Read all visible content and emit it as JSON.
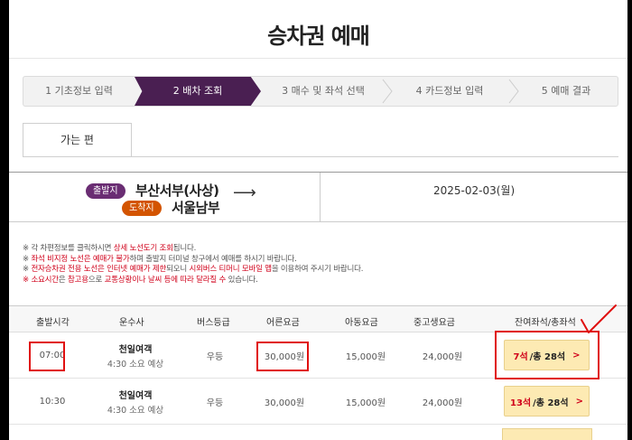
{
  "page": {
    "title": "승차권 예매"
  },
  "steps": [
    {
      "label": "1 기초정보 입력",
      "active": false
    },
    {
      "label": "2 배차 조회",
      "active": true
    },
    {
      "label": "3 매수 및 좌석 선택",
      "active": false
    },
    {
      "label": "4 카드정보 입력",
      "active": false
    },
    {
      "label": "5 예매 결과",
      "active": false
    }
  ],
  "tab": {
    "label": "가는 편"
  },
  "route": {
    "departure_badge": "출발지",
    "departure": "부산서부(사상)",
    "arrival_badge": "도착지",
    "arrival": "서울남부",
    "arrow": "⟶",
    "date": "2025-02-03(월)"
  },
  "notes": {
    "n1a": "※ 각 차편정보를 클릭하시면 ",
    "n1b": "상세 노선도기 조회",
    "n1c": "됩니다.",
    "n2a": "※ ",
    "n2b": "좌석 비지정 노선은 예매가 불가",
    "n2c": "하며 출발지 터미널 창구에서 예매를 하시기 바랍니다.",
    "n3a": "※ ",
    "n3b": "전자승차권 전용 노선은 인터넷 예매가 제한",
    "n3c": "되오니 ",
    "n3d": "시외버스 티머니 모바일 앱",
    "n3e": "을 이용하여 주시기 바랍니다.",
    "n4a": "※ ",
    "n4b": "소요시간",
    "n4c": "은 ",
    "n4d": "참고용",
    "n4e": "으로 ",
    "n4f": "교통상황이나 날씨 등에 따라 달라질 수",
    "n4g": " 있습니다."
  },
  "table": {
    "headers": {
      "time": "출발시각",
      "company": "운수사",
      "grade": "버스등급",
      "adult": "어른요금",
      "child": "아동요금",
      "teen": "중고생요금",
      "seats": "잔여좌석/총좌석"
    },
    "rows": [
      {
        "time": "07:00",
        "company": "천일여객",
        "duration": "4:30 소요 예상",
        "grade": "우등",
        "adult": "30,000원",
        "child": "15,000원",
        "teen": "24,000원",
        "remaining": "7석",
        "total": "/총 28석",
        "chevron": ">"
      },
      {
        "time": "10:30",
        "company": "천일여객",
        "duration": "4:30 소요 예상",
        "grade": "우등",
        "adult": "30,000원",
        "child": "15,000원",
        "teen": "24,000원",
        "remaining": "13석",
        "total": "/총 28석",
        "chevron": ">"
      }
    ]
  },
  "colors": {
    "accent_purple": "#4a1f52",
    "badge_departure": "#6a2d73",
    "badge_arrival": "#d35400",
    "seat_button_bg": "#fdeab3",
    "annotation_red": "#e01010",
    "notice_red": "#d0021b"
  }
}
